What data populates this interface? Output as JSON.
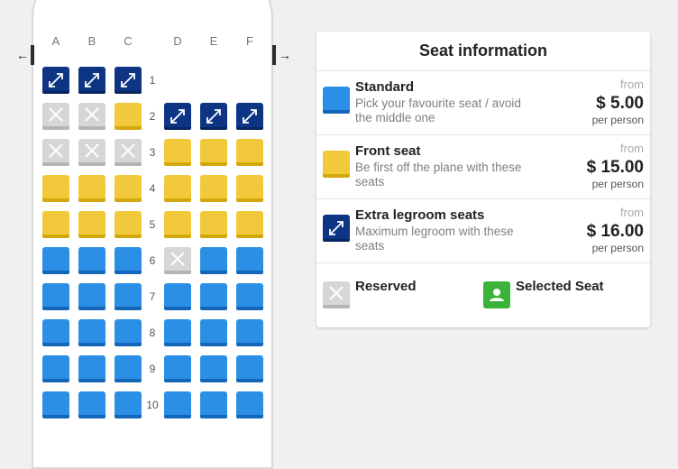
{
  "seat_map": {
    "columns": [
      "A",
      "B",
      "C",
      "D",
      "E",
      "F"
    ],
    "rows": [
      {
        "number": "1",
        "seats": [
          "legroom",
          "legroom",
          "legroom",
          null,
          null,
          null
        ]
      },
      {
        "number": "2",
        "seats": [
          "reserved",
          "reserved",
          "front",
          "legroom",
          "legroom",
          "legroom"
        ]
      },
      {
        "number": "3",
        "seats": [
          "reserved",
          "reserved",
          "reserved",
          "front",
          "front",
          "front"
        ]
      },
      {
        "number": "4",
        "seats": [
          "front",
          "front",
          "front",
          "front",
          "front",
          "front"
        ]
      },
      {
        "number": "5",
        "seats": [
          "front",
          "front",
          "front",
          "front",
          "front",
          "front"
        ]
      },
      {
        "number": "6",
        "seats": [
          "standard",
          "standard",
          "standard",
          "reserved",
          "standard",
          "standard"
        ]
      },
      {
        "number": "7",
        "seats": [
          "standard",
          "standard",
          "standard",
          "standard",
          "standard",
          "standard"
        ]
      },
      {
        "number": "8",
        "seats": [
          "standard",
          "standard",
          "standard",
          "standard",
          "standard",
          "standard"
        ]
      },
      {
        "number": "9",
        "seats": [
          "standard",
          "standard",
          "standard",
          "standard",
          "standard",
          "standard"
        ]
      },
      {
        "number": "10",
        "seats": [
          "standard",
          "standard",
          "standard",
          "standard",
          "standard",
          "standard"
        ]
      }
    ],
    "exit_left_icon": "arrow-left-icon",
    "exit_right_icon": "arrow-right-icon"
  },
  "seat_info": {
    "title": "Seat information",
    "types": [
      {
        "name": "Standard",
        "description": "Pick your favourite seat / avoid the middle one",
        "from": "from",
        "price": "$ 5.00",
        "per": "per person"
      },
      {
        "name": "Front seat",
        "description": "Be first off the plane with these seats",
        "from": "from",
        "price": "$ 15.00",
        "per": "per person"
      },
      {
        "name": "Extra legroom seats",
        "description": "Maximum legroom with these seats",
        "from": "from",
        "price": "$ 16.00",
        "per": "per person"
      }
    ],
    "legend": {
      "reserved": "Reserved",
      "selected": "Selected Seat"
    }
  },
  "colors": {
    "standard": "#2b90e5",
    "front": "#f2c93a",
    "legroom": "#0d3584",
    "reserved": "#d6d6d6",
    "selected": "#3bb33b"
  },
  "icons": {
    "legroom": "expand-arrows-icon",
    "reserved": "x-icon",
    "selected": "person-icon"
  }
}
